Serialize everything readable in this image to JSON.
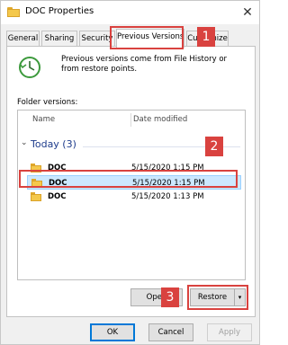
{
  "window": {
    "title": "DOC Properties",
    "close_glyph": "✕"
  },
  "tabs": [
    {
      "label": "General",
      "active": false
    },
    {
      "label": "Sharing",
      "active": false
    },
    {
      "label": "Security",
      "active": false
    },
    {
      "label": "Previous Versions",
      "active": true
    },
    {
      "label": "Customize",
      "active": false
    }
  ],
  "panel": {
    "description": "Previous versions come from File History or from restore points.",
    "folder_versions_label": "Folder versions:"
  },
  "list": {
    "columns": {
      "name": "Name",
      "date": "Date modified"
    },
    "group": {
      "label": "Today (3)",
      "chevron": "⌄"
    },
    "rows": [
      {
        "name": "DOC",
        "date": "5/15/2020 1:15 PM",
        "selected": false
      },
      {
        "name": "DOC",
        "date": "5/15/2020 1:15 PM",
        "selected": true
      },
      {
        "name": "DOC",
        "date": "5/15/2020 1:13 PM",
        "selected": false
      }
    ]
  },
  "actions": {
    "open_label": "Open",
    "restore_label": "Restore",
    "dropdown_glyph": "▾"
  },
  "footer": {
    "ok_label": "OK",
    "cancel_label": "Cancel",
    "apply_label": "Apply"
  },
  "annotations": {
    "one": "1",
    "two": "2",
    "three": "3"
  },
  "colors": {
    "highlight": "#d9423f",
    "selection": "#cce8ff",
    "group_text": "#1e3c8c"
  },
  "icons": {
    "folder": "folder-icon",
    "history": "file-history-icon",
    "close": "close-icon"
  }
}
